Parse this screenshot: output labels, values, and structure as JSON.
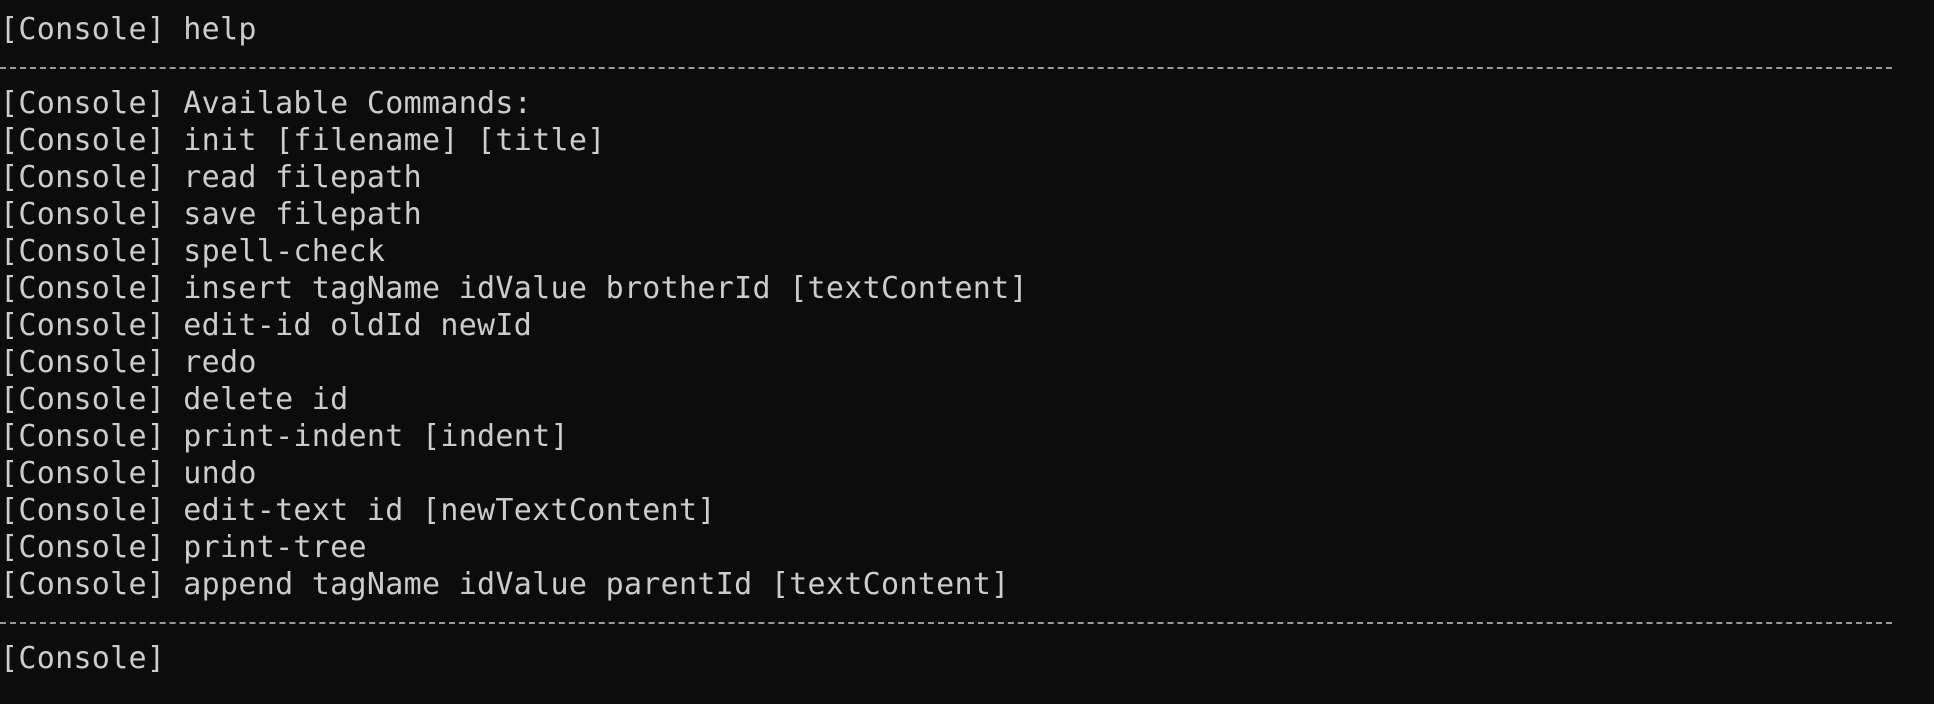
{
  "terminal": {
    "prefix": "[Console]",
    "command": "help",
    "header": "Available Commands:",
    "commands": [
      "init [filename] [title]",
      "read filepath",
      "save filepath",
      "spell-check",
      "insert tagName idValue brotherId [textContent]",
      "edit-id oldId newId",
      "redo",
      "delete id",
      "print-indent [indent]",
      "undo",
      "edit-text id [newTextContent]",
      "print-tree",
      "append tagName idValue parentId [textContent]"
    ],
    "input_value": ""
  }
}
